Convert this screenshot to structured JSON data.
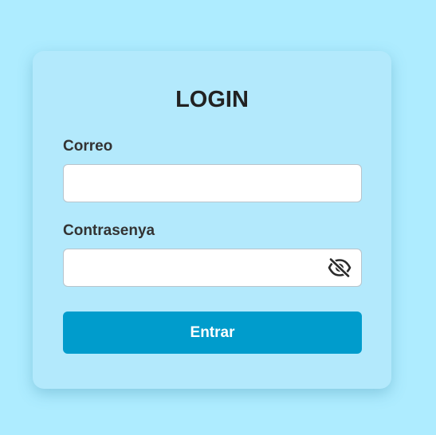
{
  "login": {
    "title": "LOGIN",
    "email_label": "Correo",
    "email_value": "",
    "password_label": "Contrasenya",
    "password_value": "",
    "password_toggle_icon": "eye-slash-icon",
    "submit_label": "Entrar"
  },
  "colors": {
    "background": "#aeecff",
    "card": "#b3e9fc",
    "button": "#009ccc",
    "button_text": "#ffffff",
    "text": "#222222"
  }
}
